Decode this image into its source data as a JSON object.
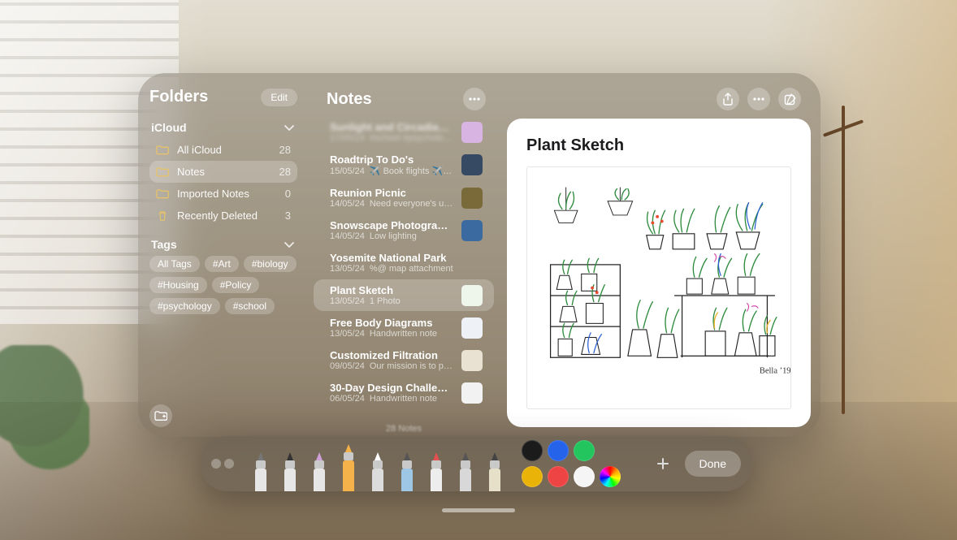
{
  "sidebar": {
    "title": "Folders",
    "edit_label": "Edit",
    "sections": {
      "icloud": {
        "title": "iCloud",
        "folders": [
          {
            "name": "All iCloud",
            "count": "28",
            "icon": "folder"
          },
          {
            "name": "Notes",
            "count": "28",
            "icon": "folder",
            "selected": true
          },
          {
            "name": "Imported Notes",
            "count": "0",
            "icon": "folder"
          },
          {
            "name": "Recently Deleted",
            "count": "3",
            "icon": "trash"
          }
        ]
      },
      "tags": {
        "title": "Tags",
        "items": [
          "All Tags",
          "#Art",
          "#biology",
          "#Housing",
          "#Policy",
          "#psychology",
          "#school"
        ]
      }
    }
  },
  "notes_column": {
    "title": "Notes",
    "footer": "28 Notes",
    "items": [
      {
        "title": "Sunlight and Circadian Rhyt…",
        "date": "17/05/24",
        "preview": "#school #psychology #b…",
        "thumb": "#d8b4e2",
        "blurred": true
      },
      {
        "title": "Roadtrip To Do's",
        "date": "15/05/24",
        "preview": "✈️ Book flights ✈️ chec…",
        "thumb": "#374a63"
      },
      {
        "title": "Reunion Picnic",
        "date": "14/05/24",
        "preview": "Need everyone's update…",
        "thumb": "#7a6a3a"
      },
      {
        "title": "Snowscape Photography",
        "date": "14/05/24",
        "preview": "Low lighting",
        "thumb": "#3b6aa0"
      },
      {
        "title": "Yosemite National Park",
        "date": "13/05/24",
        "preview": "%@ map attachment",
        "thumb": ""
      },
      {
        "title": "Plant Sketch",
        "date": "13/05/24",
        "preview": "1 Photo",
        "thumb": "#eef5ea",
        "selected": true
      },
      {
        "title": "Free Body Diagrams",
        "date": "13/05/24",
        "preview": "Handwritten note",
        "thumb": "#eef1f5"
      },
      {
        "title": "Customized Filtration",
        "date": "09/05/24",
        "preview": "Our mission is to provid…",
        "thumb": "#e9e2d2"
      },
      {
        "title": "30-Day Design Challenge",
        "date": "06/05/24",
        "preview": "Handwritten note",
        "thumb": "#f2f2f2"
      }
    ]
  },
  "detail": {
    "title": "Plant Sketch",
    "signature": "Bella ’19"
  },
  "palette": {
    "tools": [
      {
        "name": "pen",
        "tip": "#777",
        "body": "#e6e6e6"
      },
      {
        "name": "fine-pen",
        "tip": "#333",
        "body": "#e6e6e6"
      },
      {
        "name": "marker",
        "tip": "#cfa0d8",
        "body": "#e6e6e6"
      },
      {
        "name": "highlighter",
        "tip": "#f6b24a",
        "body": "#f6b24a",
        "selected": true
      },
      {
        "name": "eraser",
        "tip": "#fff",
        "body": "#dcdcdc"
      },
      {
        "name": "pencil",
        "tip": "#555",
        "body": "#9ec7e6"
      },
      {
        "name": "crayon",
        "tip": "#e35050",
        "body": "#ededed"
      },
      {
        "name": "fountain-pen",
        "tip": "#555",
        "body": "#d8d8d8"
      },
      {
        "name": "brush",
        "tip": "#444",
        "body": "#e6e0c8"
      }
    ],
    "colors": [
      "#1b1b1b",
      "#2563eb",
      "#22c55e",
      "",
      "#eab308",
      "#ef4444",
      "#f5f5f5",
      "rainbow"
    ],
    "done_label": "Done"
  }
}
